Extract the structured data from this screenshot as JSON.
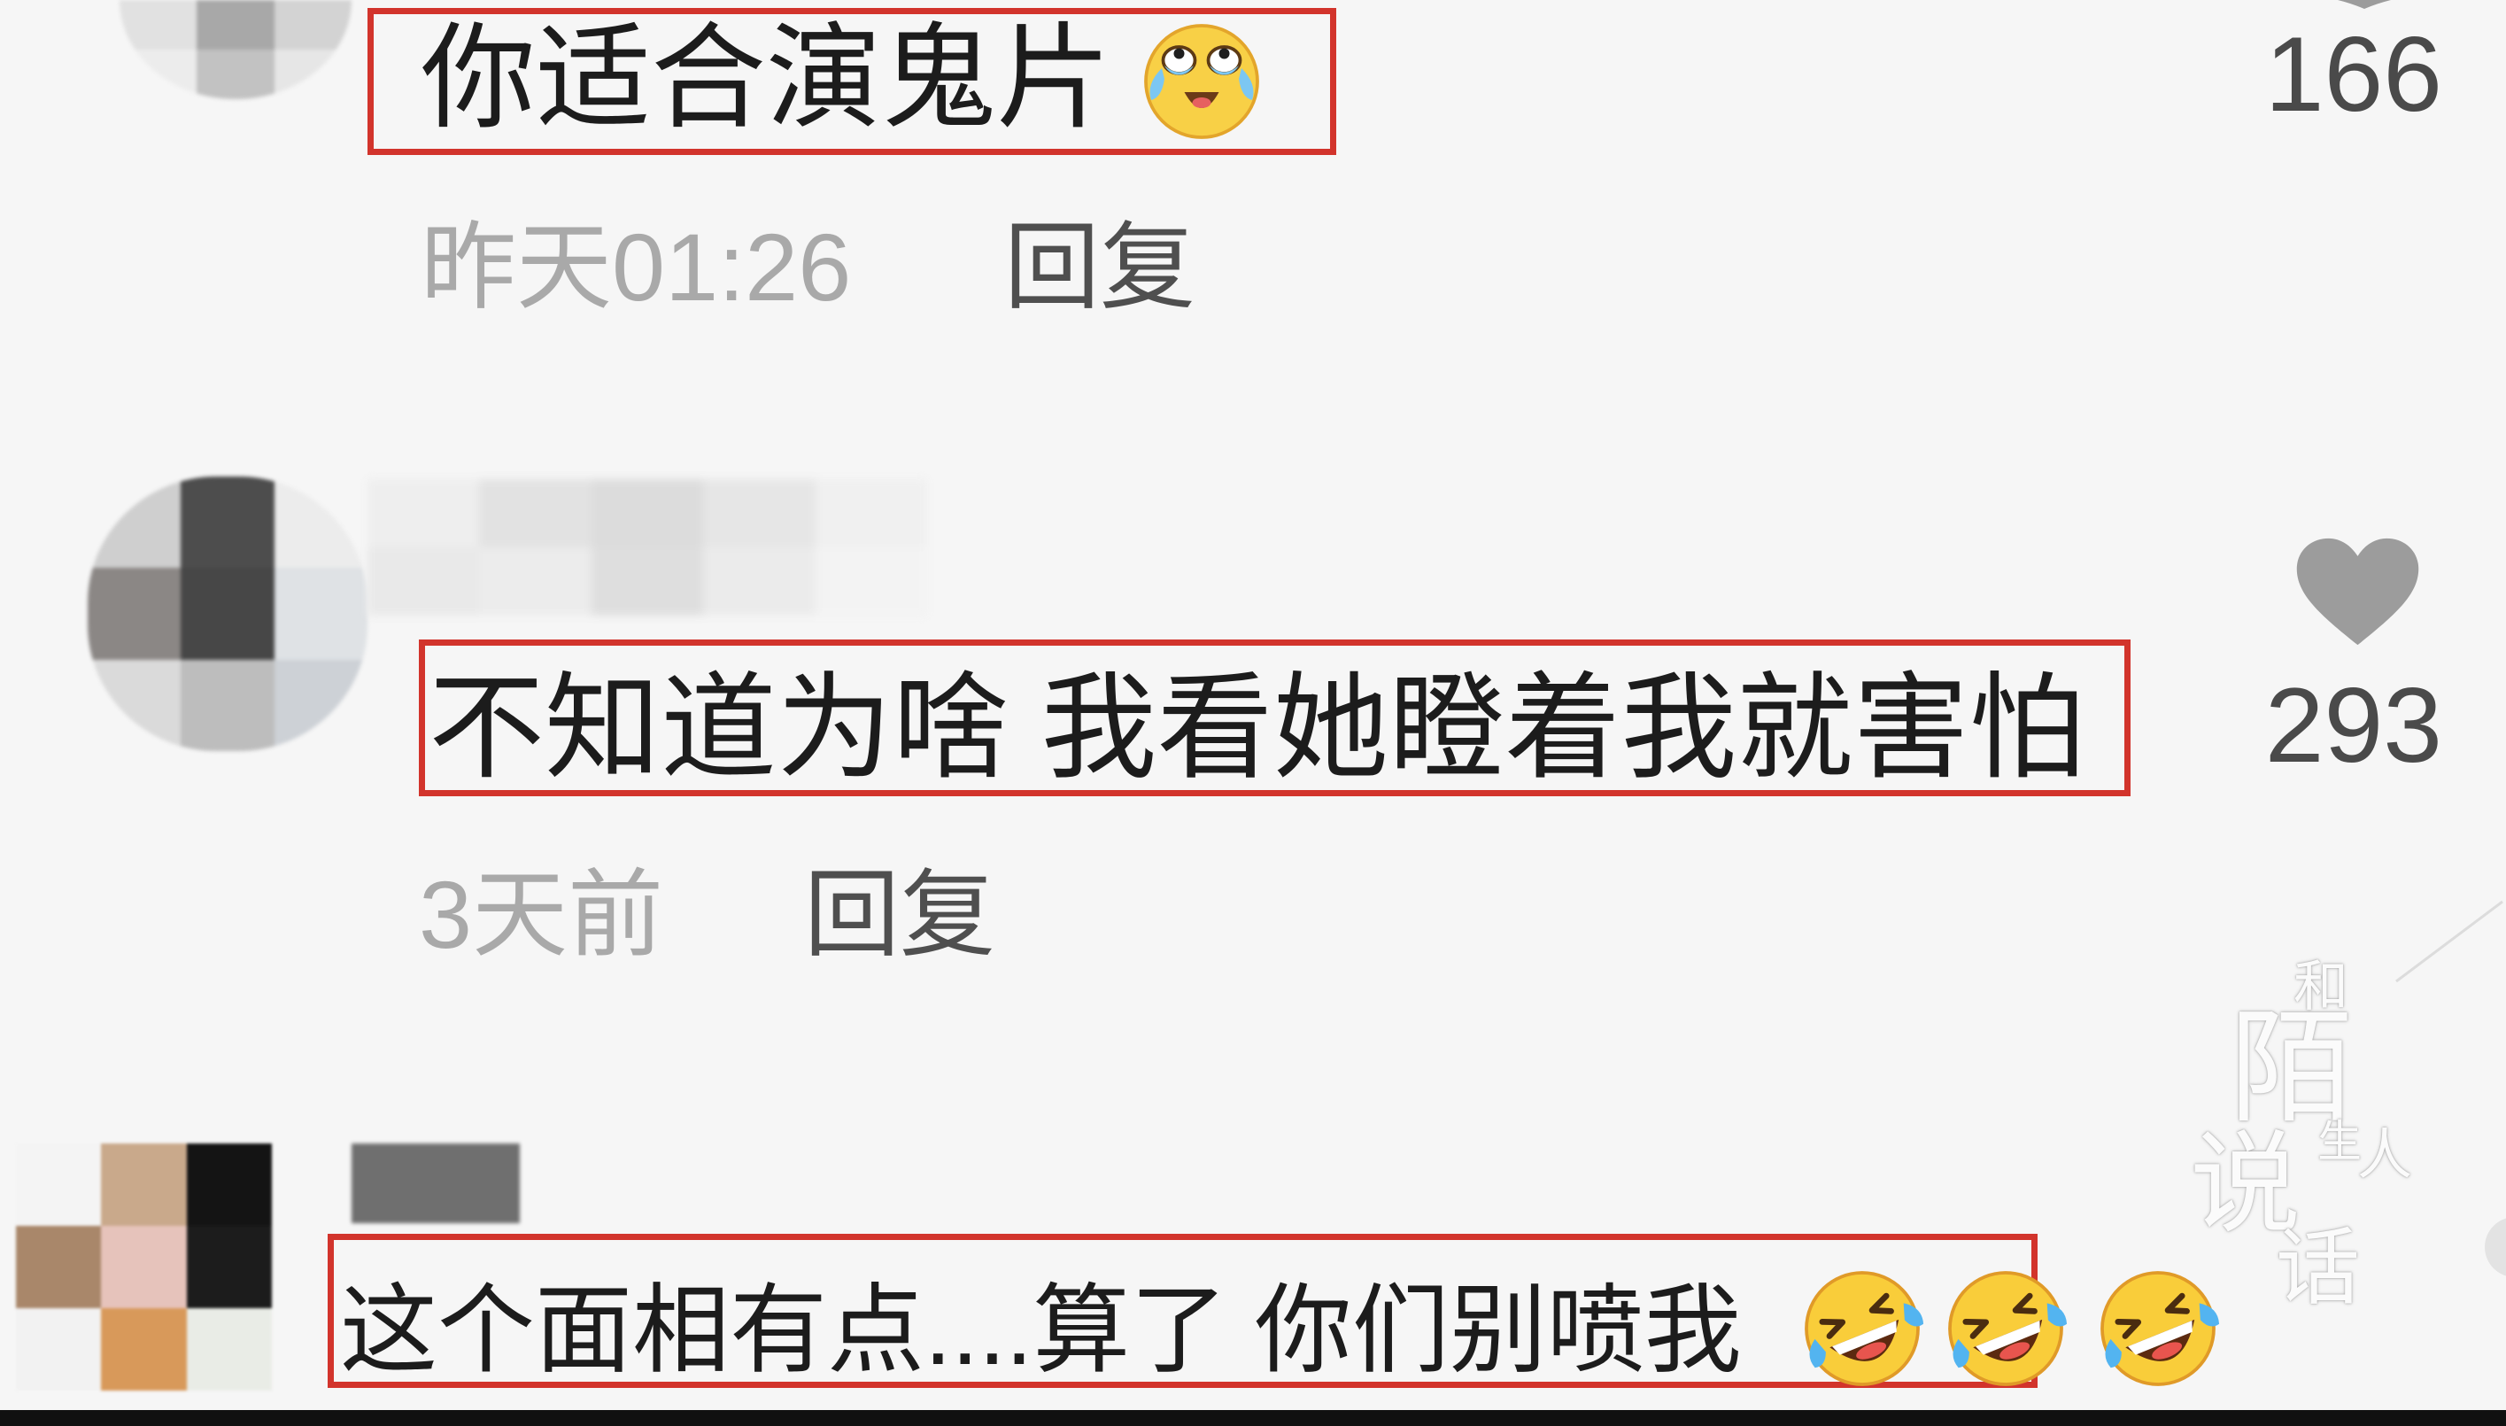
{
  "comments": [
    {
      "text": "你适合演鬼片",
      "emoji": [
        "tears-of-joy-icon"
      ],
      "time": "昨天01:26",
      "reply_label": "回复",
      "likes": "166",
      "like_icon": "heart-icon"
    },
    {
      "text": "不知道为啥 我看她瞪着我就害怕",
      "time": "3天前",
      "reply_label": "回复",
      "likes": "293",
      "like_icon": "heart-icon"
    },
    {
      "text": "这个面相有点....算了 你们别喷我",
      "emoji": [
        "rofl-icon",
        "rofl-icon",
        "rofl-icon"
      ],
      "like_icon": "heart-icon"
    }
  ],
  "watermark": {
    "chars": [
      "和",
      "陌",
      "生",
      "人",
      "说",
      "话"
    ]
  },
  "colors": {
    "highlight_box": "#d2342c",
    "background": "#f6f6f6",
    "text_primary": "#1c1c1c",
    "text_secondary": "#a9a9a9",
    "reply": "#4f4f4f",
    "like_icon": "#9c9c9c",
    "count": "#4a4a4a"
  }
}
